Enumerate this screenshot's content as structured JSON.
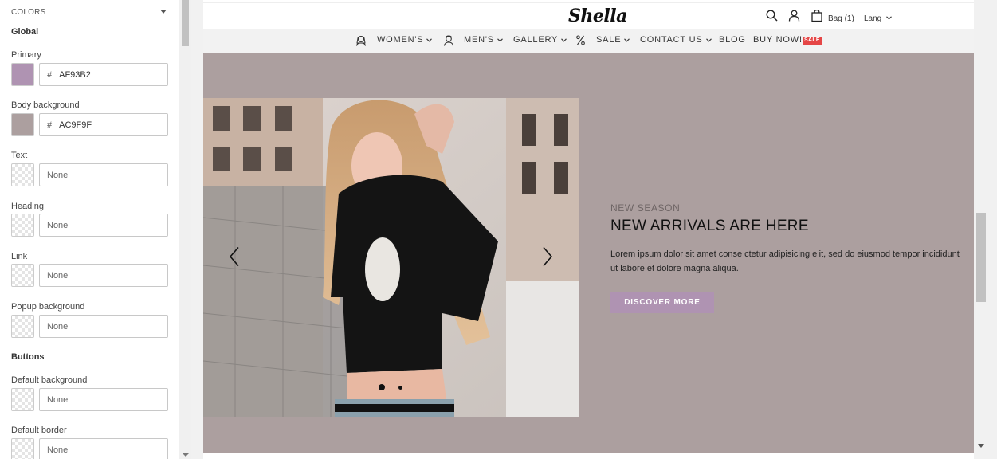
{
  "panel": {
    "header": "COLORS",
    "global_section": "Global",
    "fields": [
      {
        "label": "Primary",
        "value": "AF93B2",
        "swatch": "#af93b2"
      },
      {
        "label": "Body background",
        "value": "AC9F9F",
        "swatch": "#ac9f9f"
      },
      {
        "label": "Text",
        "value": "None"
      },
      {
        "label": "Heading",
        "value": "None"
      },
      {
        "label": "Link",
        "value": "None"
      },
      {
        "label": "Popup background",
        "value": "None"
      }
    ],
    "hash": "#",
    "buttons_section": "Buttons",
    "button_fields": [
      {
        "label": "Default background",
        "value": "None"
      },
      {
        "label": "Default border",
        "value": "None"
      }
    ]
  },
  "site": {
    "logo": "Shella",
    "bag": "Bag (1)",
    "lang": "Lang",
    "nav": [
      "WOMEN'S",
      "MEN'S",
      "GALLERY",
      "SALE",
      "CONTACT US",
      "BLOG",
      "BUY NOW!"
    ],
    "sale_badge": "SALE",
    "hero": {
      "subtitle": "NEW SEASON",
      "title": "NEW ARRIVALS ARE HERE",
      "description": "Lorem ipsum dolor sit amet conse ctetur adipisicing elit, sed do eiusmod tempor incididunt ut labore et dolore magna aliqua.",
      "button": "DISCOVER MORE",
      "slides_total": 2,
      "slide_active": 1
    }
  },
  "colors": {
    "primary": "#af93b2",
    "body_background": "#ac9f9f",
    "sale": "#e54646"
  }
}
